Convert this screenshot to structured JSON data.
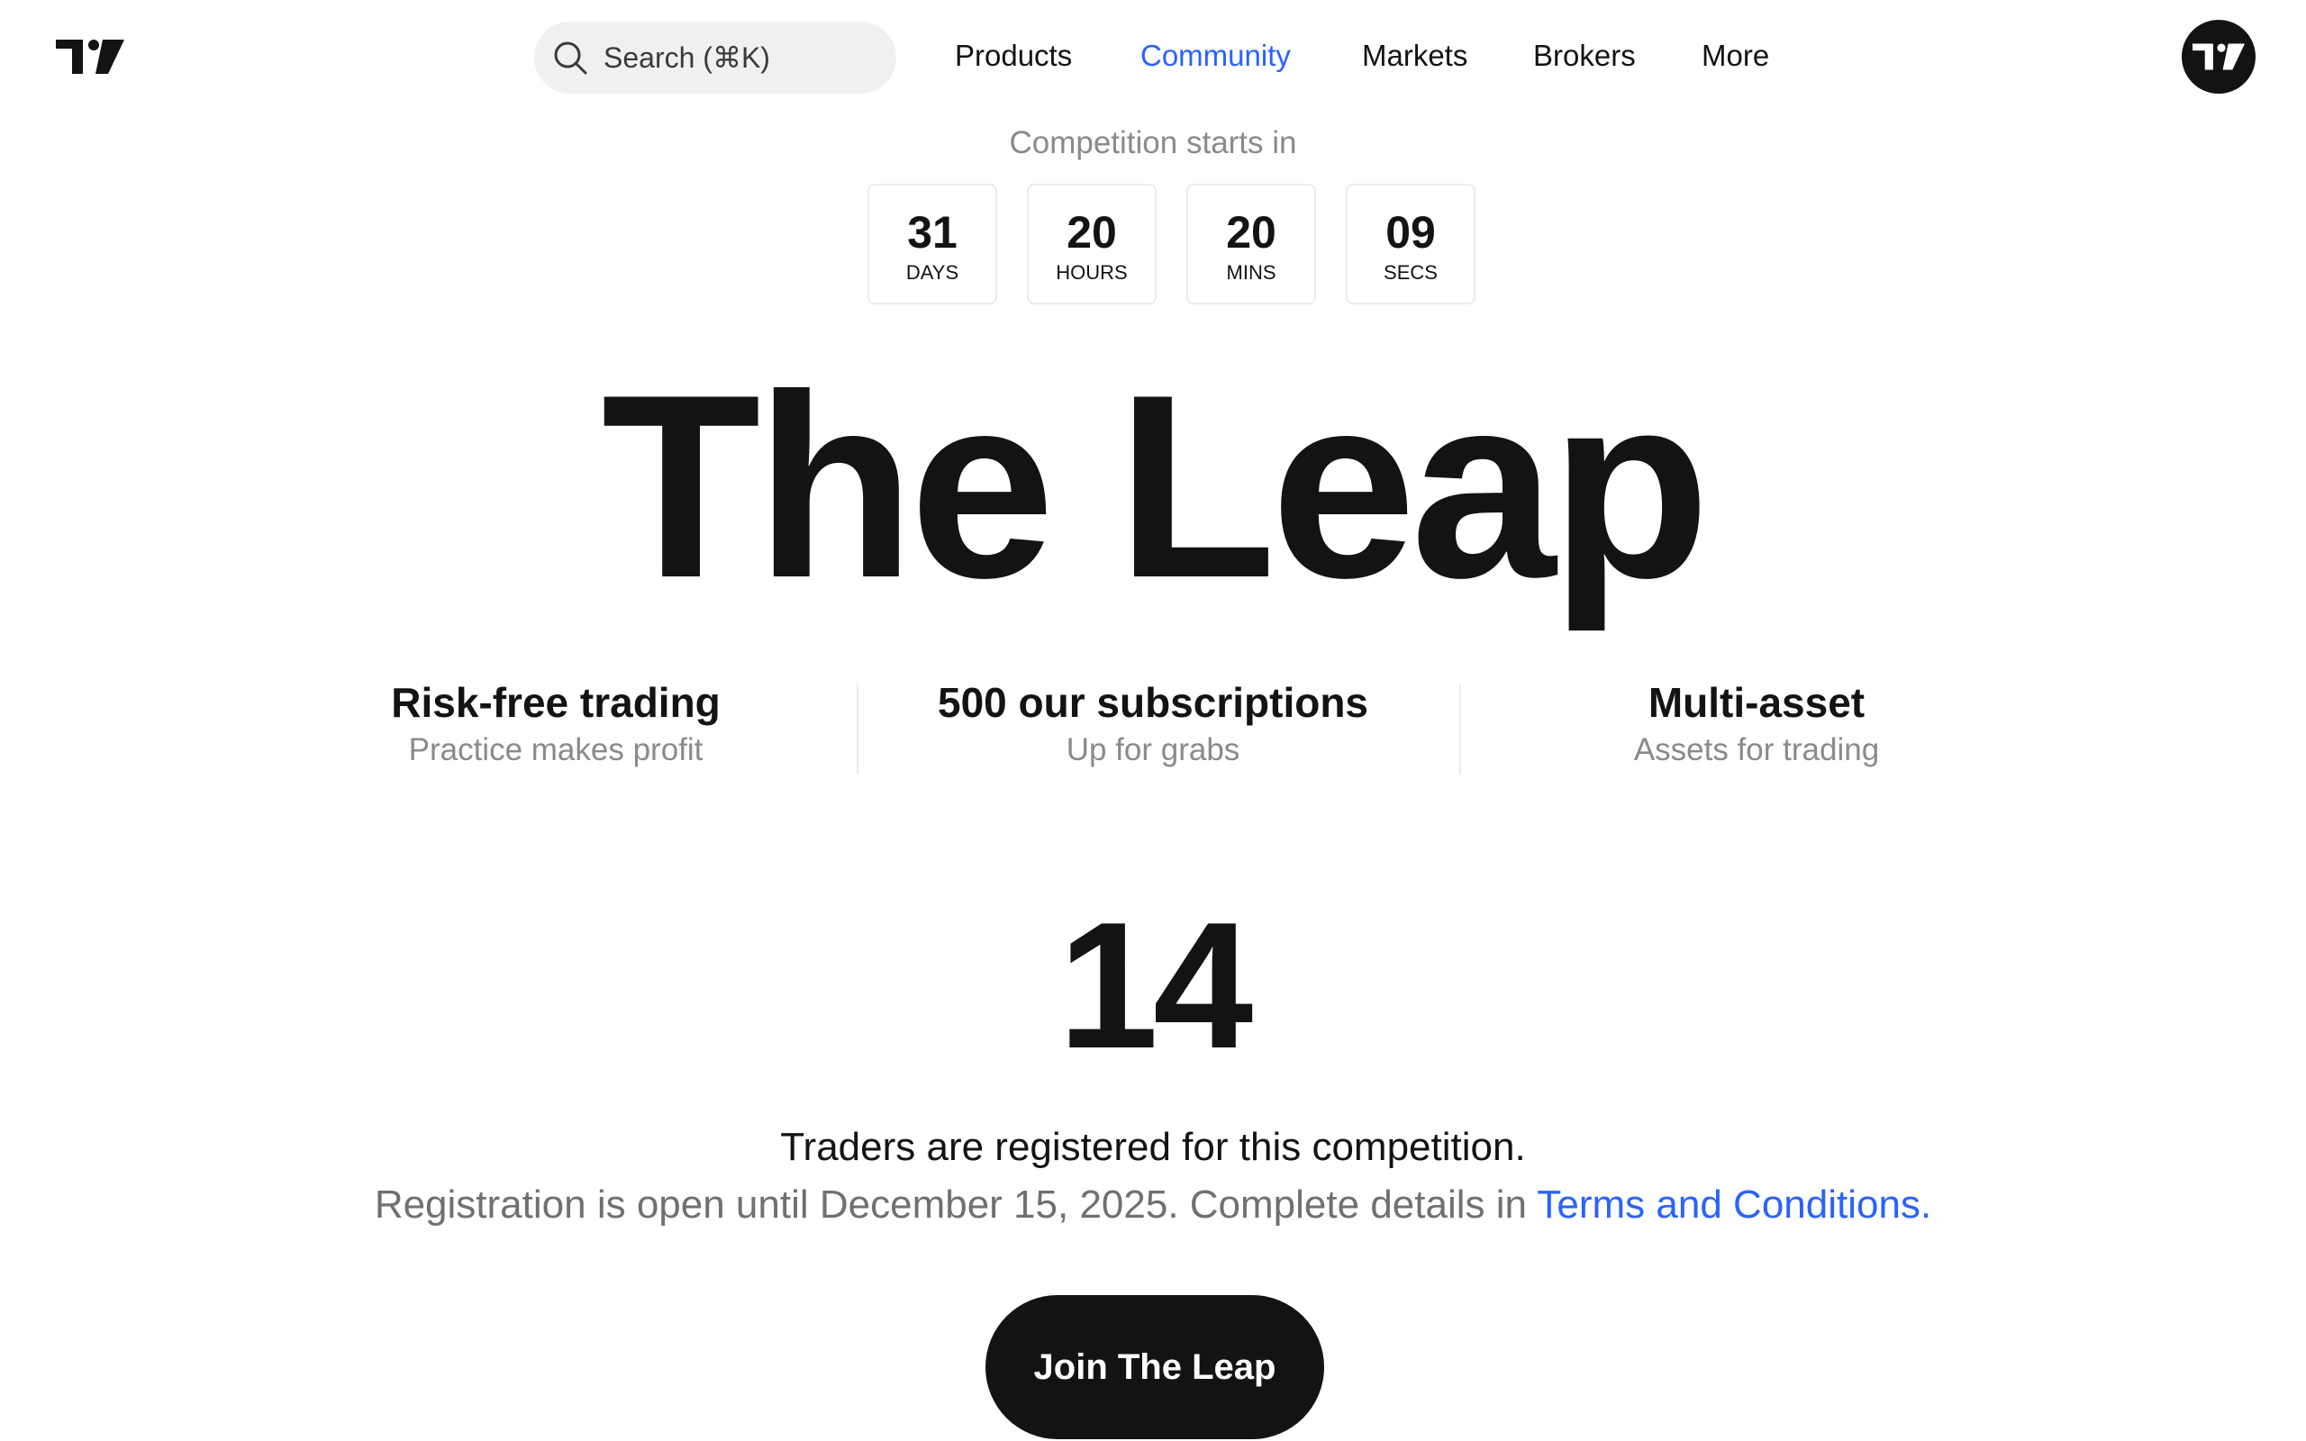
{
  "header": {
    "search_placeholder": "Search (⌘K)",
    "nav": [
      {
        "label": "Products"
      },
      {
        "label": "Community",
        "active": true
      },
      {
        "label": "Markets"
      },
      {
        "label": "Brokers"
      },
      {
        "label": "More"
      }
    ],
    "logo_icon": "tradingview-logo-icon",
    "avatar_icon": "tradingview-logo-icon"
  },
  "countdown": {
    "label": "Competition starts in",
    "units": [
      {
        "value": "31",
        "unit": "DAYS"
      },
      {
        "value": "20",
        "unit": "HOURS"
      },
      {
        "value": "20",
        "unit": "MINS"
      },
      {
        "value": "09",
        "unit": "SECS"
      }
    ]
  },
  "hero": {
    "title": "The Leap"
  },
  "features": [
    {
      "title": "Risk-free trading",
      "subtitle": "Practice makes profit"
    },
    {
      "title": "500 our subscriptions",
      "subtitle": "Up for grabs"
    },
    {
      "title": "Multi-asset",
      "subtitle": "Assets for trading"
    }
  ],
  "registration": {
    "count": "14",
    "line": "Traders are registered for this competition.",
    "note_prefix": "Registration is open until December 15, 2025. Complete details in ",
    "terms_link": "Terms and Conditions."
  },
  "cta": {
    "label": "Join The Leap"
  },
  "colors": {
    "accent": "#2962ff",
    "text": "#131313",
    "muted": "#8a8a8a",
    "button_bg": "#131313"
  }
}
